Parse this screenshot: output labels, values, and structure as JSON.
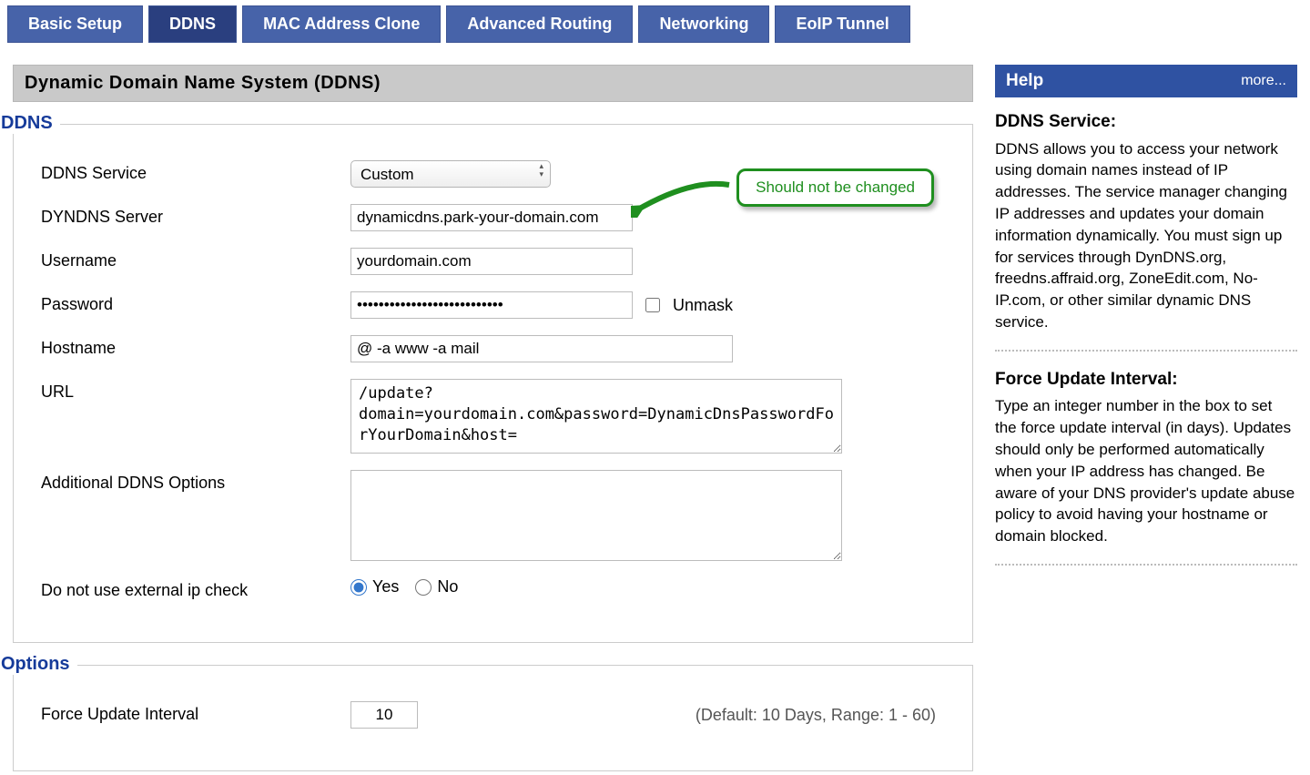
{
  "tabs": [
    {
      "label": "Basic Setup"
    },
    {
      "label": "DDNS"
    },
    {
      "label": "MAC Address Clone"
    },
    {
      "label": "Advanced Routing"
    },
    {
      "label": "Networking"
    },
    {
      "label": "EoIP Tunnel"
    }
  ],
  "active_tab_index": 1,
  "title": "Dynamic Domain Name System (DDNS)",
  "section_ddns": "DDNS",
  "section_options": "Options",
  "labels": {
    "ddns_service": "DDNS Service",
    "dyndns_server": "DYNDNS Server",
    "username": "Username",
    "password": "Password",
    "hostname": "Hostname",
    "url": "URL",
    "additional": "Additional DDNS Options",
    "noextip": "Do not use external ip check",
    "force_update": "Force Update Interval",
    "unmask": "Unmask"
  },
  "values": {
    "ddns_service": "Custom",
    "dyndns_server": "dynamicdns.park-your-domain.com",
    "username": "yourdomain.com",
    "password": "•••••••••••••••••••••••••••",
    "hostname": "@ -a www -a mail",
    "url": "/update?domain=yourdomain.com&password=DynamicDnsPasswordForYourDomain&host=",
    "additional": "",
    "noextip": "Yes",
    "force_update": "10"
  },
  "radio": {
    "yes": "Yes",
    "no": "No"
  },
  "hints": {
    "force_update": "(Default: 10 Days, Range: 1 - 60)"
  },
  "callout": "Should not be changed",
  "help": {
    "title": "Help",
    "more": "more...",
    "blocks": [
      {
        "heading": "DDNS Service:",
        "body": "DDNS allows you to access your network using domain names instead of IP addresses. The service manager changing IP addresses and updates your domain information dynamically. You must sign up for services through DynDNS.org, freedns.affraid.org, ZoneEdit.com, No-IP.com, or other similar dynamic DNS service."
      },
      {
        "heading": "Force Update Interval:",
        "body": "Type an integer number in the box to set the force update interval (in days). Updates should only be performed automatically when your IP address has changed. Be aware of your DNS provider's update abuse policy to avoid having your hostname or domain blocked."
      }
    ]
  }
}
